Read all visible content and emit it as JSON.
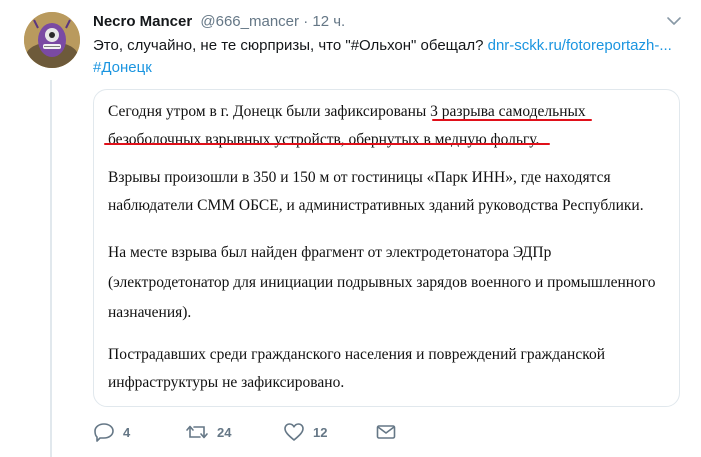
{
  "tweet": {
    "author_name": "Necro Mancer",
    "handle": "@666_mancer",
    "separator": "·",
    "time": "12 ч.",
    "text_before": "Это, случайно, не те сюрпризы, что \"#Ольхон\" обещал? ",
    "link_text": "dnr-sckk.ru/fotoreportazh-...",
    "hashtag": "#Донецк"
  },
  "image_card": {
    "para1_line1_a": "Сегодня утром в г. Донецк были зафиксированы ",
    "para1_line1_b": "3 разрыва самодельных",
    "para1_line2": "безоболочных взрывных устройств, обернутых в медную фольгу.",
    "para2_line1": "Взрывы произошли в 350 и 150 м от гостиницы «Парк ИНН», где находятся",
    "para2_line2": "наблюдатели СММ ОБСЕ, и административных зданий руководства Республики.",
    "para3_line1": "На месте взрыва был найден фрагмент от электродетонатора ЭДПр",
    "para3_line2": "(электродетонатор для инициации подрывных зарядов военного и промышленного",
    "para3_line3": "назначения).",
    "para4_line1": "Пострадавших среди гражданского населения и повреждений гражданской",
    "para4_line2": "инфраструктуры не зафиксировано."
  },
  "actions": {
    "reply_count": "4",
    "retweet_count": "24",
    "like_count": "12"
  },
  "colors": {
    "link": "#1b95e0",
    "secondary": "#657786",
    "underline": "#e0101a"
  }
}
